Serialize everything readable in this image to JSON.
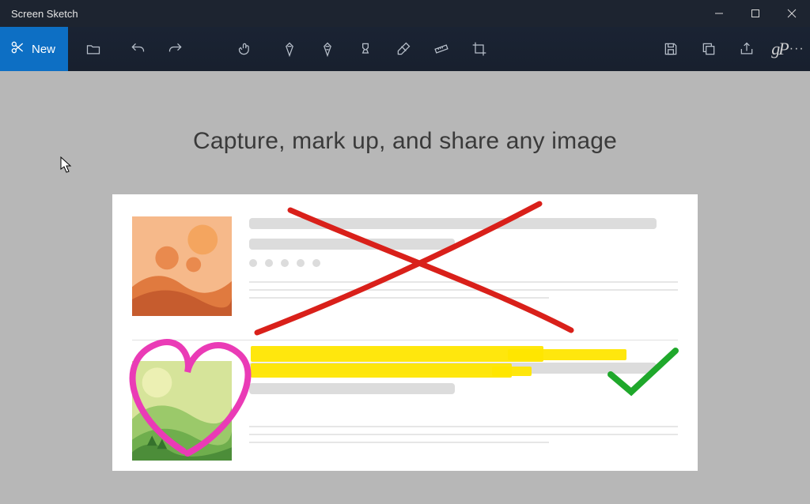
{
  "app": {
    "title": "Screen Sketch"
  },
  "toolbar": {
    "new_label": "New"
  },
  "content": {
    "headline": "Capture, mark up, and share any image"
  },
  "colors": {
    "accent": "#0d6fc4",
    "x_stroke": "#d9201a",
    "heart_stroke": "#ea3bb6",
    "highlight": "#ffe600",
    "check_stroke": "#1fa82b"
  }
}
